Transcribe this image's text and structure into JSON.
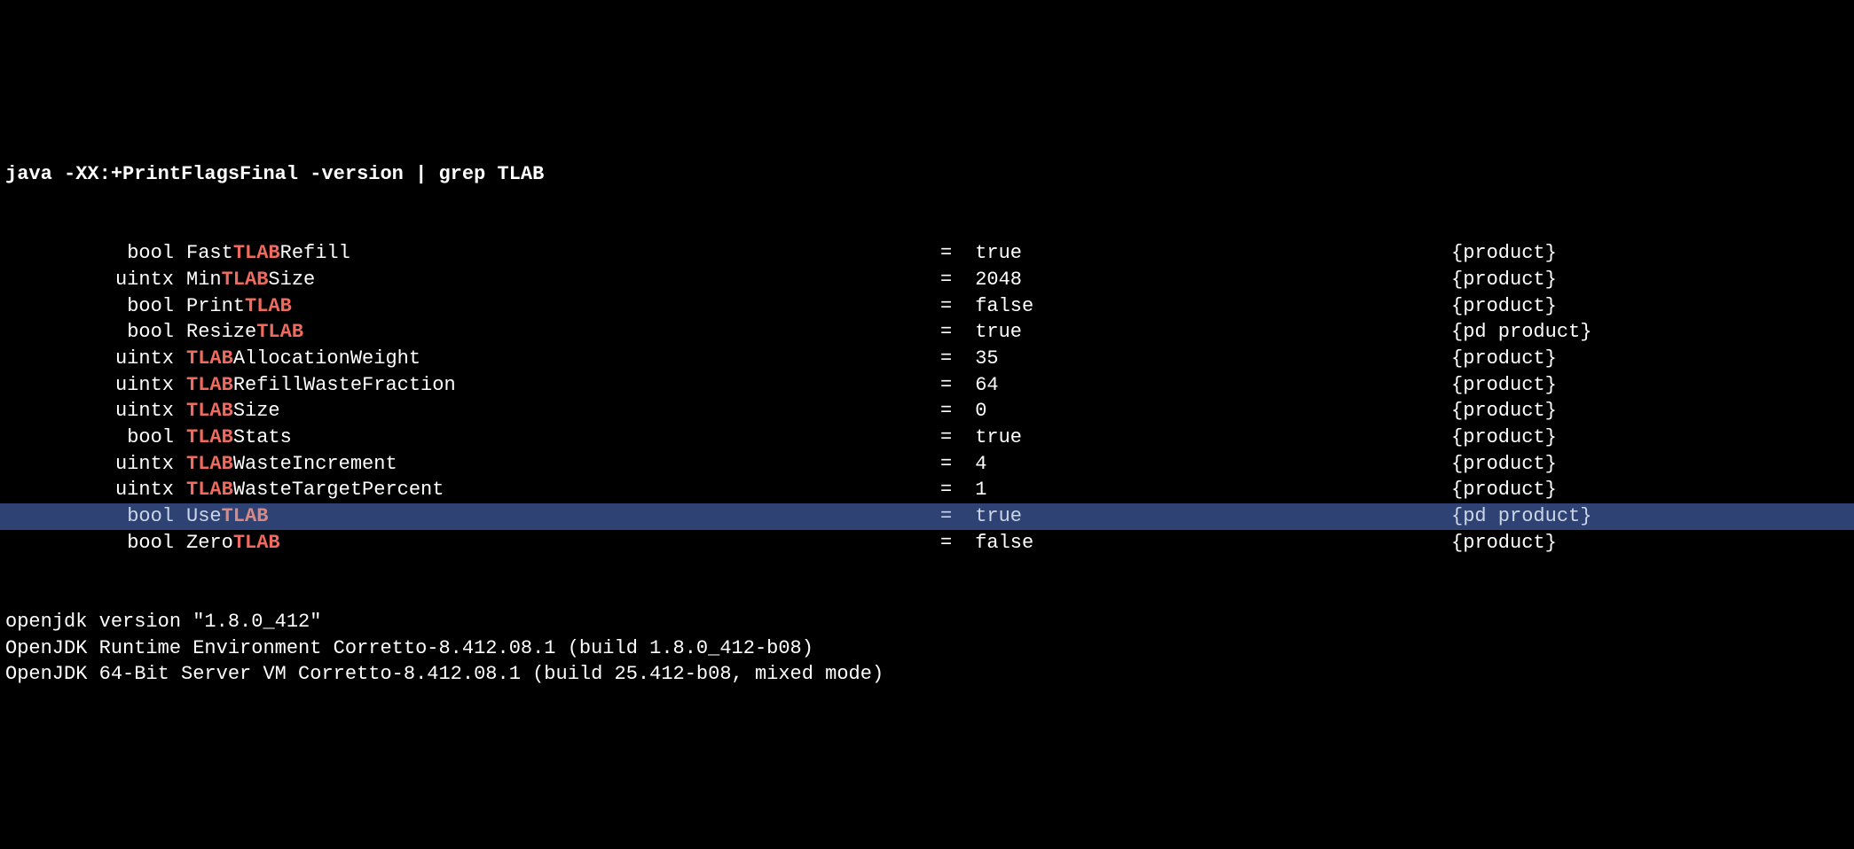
{
  "command": {
    "prefix": "java -XX:+PrintFlagsFinal -version | grep ",
    "match": "TLAB"
  },
  "match": "TLAB",
  "flags": [
    {
      "type": "bool",
      "name_pre": "Fast",
      "name_mid": "TLAB",
      "name_post": "Refill",
      "value": "true",
      "category": "{product}",
      "highlighted": false
    },
    {
      "type": "uintx",
      "name_pre": "Min",
      "name_mid": "TLAB",
      "name_post": "Size",
      "value": "2048",
      "category": "{product}",
      "highlighted": false
    },
    {
      "type": "bool",
      "name_pre": "Print",
      "name_mid": "TLAB",
      "name_post": "",
      "value": "false",
      "category": "{product}",
      "highlighted": false
    },
    {
      "type": "bool",
      "name_pre": "Resize",
      "name_mid": "TLAB",
      "name_post": "",
      "value": "true",
      "category": "{pd product}",
      "highlighted": false
    },
    {
      "type": "uintx",
      "name_pre": "",
      "name_mid": "TLAB",
      "name_post": "AllocationWeight",
      "value": "35",
      "category": "{product}",
      "highlighted": false
    },
    {
      "type": "uintx",
      "name_pre": "",
      "name_mid": "TLAB",
      "name_post": "RefillWasteFraction",
      "value": "64",
      "category": "{product}",
      "highlighted": false
    },
    {
      "type": "uintx",
      "name_pre": "",
      "name_mid": "TLAB",
      "name_post": "Size",
      "value": "0",
      "category": "{product}",
      "highlighted": false
    },
    {
      "type": "bool",
      "name_pre": "",
      "name_mid": "TLAB",
      "name_post": "Stats",
      "value": "true",
      "category": "{product}",
      "highlighted": false
    },
    {
      "type": "uintx",
      "name_pre": "",
      "name_mid": "TLAB",
      "name_post": "WasteIncrement",
      "value": "4",
      "category": "{product}",
      "highlighted": false
    },
    {
      "type": "uintx",
      "name_pre": "",
      "name_mid": "TLAB",
      "name_post": "WasteTargetPercent",
      "value": "1",
      "category": "{product}",
      "highlighted": false
    },
    {
      "type": "bool",
      "name_pre": "Use",
      "name_mid": "TLAB",
      "name_post": "",
      "value": "true",
      "category": "{pd product}",
      "highlighted": true
    },
    {
      "type": "bool",
      "name_pre": "Zero",
      "name_mid": "TLAB",
      "name_post": "",
      "value": "false",
      "category": "{product}",
      "highlighted": false
    }
  ],
  "footer": [
    "openjdk version \"1.8.0_412\"",
    "OpenJDK Runtime Environment Corretto-8.412.08.1 (build 1.8.0_412-b08)",
    "OpenJDK 64-Bit Server VM Corretto-8.412.08.1 (build 25.412-b08, mixed mode)"
  ]
}
